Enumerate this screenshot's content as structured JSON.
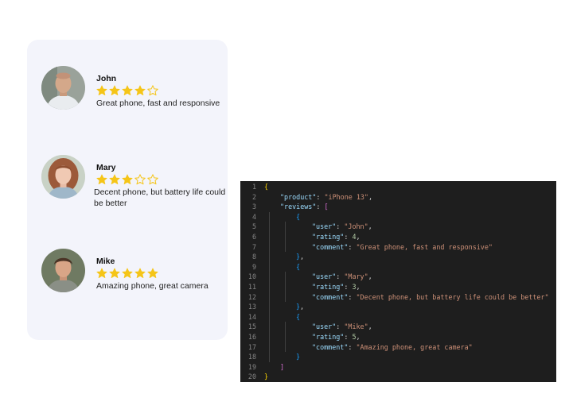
{
  "reviews": [
    {
      "name": "John",
      "rating": 4,
      "max_rating": 5,
      "comment": "Great phone, fast and responsive",
      "avatar_icon": "person-photo-john"
    },
    {
      "name": "Mary",
      "rating": 3,
      "max_rating": 5,
      "comment": "Decent phone, but battery life could be better",
      "avatar_icon": "person-photo-mary"
    },
    {
      "name": "Mike",
      "rating": 5,
      "max_rating": 5,
      "comment": "Amazing phone, great camera",
      "avatar_icon": "person-photo-mike"
    }
  ],
  "colors": {
    "star": "#f5c518",
    "card_bg": "#f3f4fb",
    "editor_bg": "#1e1e1e"
  },
  "code": {
    "line_numbers": [
      "1",
      "2",
      "3",
      "4",
      "5",
      "6",
      "7",
      "8",
      "9",
      "10",
      "11",
      "12",
      "13",
      "14",
      "15",
      "16",
      "17",
      "18",
      "19",
      "20"
    ],
    "lines": [
      [
        {
          "t": "{",
          "c": "b1"
        }
      ],
      [
        {
          "t": "\"product\"",
          "c": "key"
        },
        {
          "t": ": ",
          "c": "punc"
        },
        {
          "t": "\"iPhone 13\"",
          "c": "str"
        },
        {
          "t": ",",
          "c": "punc"
        }
      ],
      [
        {
          "t": "\"reviews\"",
          "c": "key"
        },
        {
          "t": ": ",
          "c": "punc"
        },
        {
          "t": "[",
          "c": "b2"
        }
      ],
      [
        {
          "t": "{",
          "c": "b3"
        }
      ],
      [
        {
          "t": "\"user\"",
          "c": "key"
        },
        {
          "t": ": ",
          "c": "punc"
        },
        {
          "t": "\"John\"",
          "c": "str"
        },
        {
          "t": ",",
          "c": "punc"
        }
      ],
      [
        {
          "t": "\"rating\"",
          "c": "key"
        },
        {
          "t": ": ",
          "c": "punc"
        },
        {
          "t": "4",
          "c": "num"
        },
        {
          "t": ",",
          "c": "punc"
        }
      ],
      [
        {
          "t": "\"comment\"",
          "c": "key"
        },
        {
          "t": ": ",
          "c": "punc"
        },
        {
          "t": "\"Great phone, fast and responsive\"",
          "c": "str"
        }
      ],
      [
        {
          "t": "}",
          "c": "b3"
        },
        {
          "t": ",",
          "c": "punc"
        }
      ],
      [
        {
          "t": "{",
          "c": "b3"
        }
      ],
      [
        {
          "t": "\"user\"",
          "c": "key"
        },
        {
          "t": ": ",
          "c": "punc"
        },
        {
          "t": "\"Mary\"",
          "c": "str"
        },
        {
          "t": ",",
          "c": "punc"
        }
      ],
      [
        {
          "t": "\"rating\"",
          "c": "key"
        },
        {
          "t": ": ",
          "c": "punc"
        },
        {
          "t": "3",
          "c": "num"
        },
        {
          "t": ",",
          "c": "punc"
        }
      ],
      [
        {
          "t": "\"comment\"",
          "c": "key"
        },
        {
          "t": ": ",
          "c": "punc"
        },
        {
          "t": "\"Decent phone, but battery life could be better\"",
          "c": "str"
        }
      ],
      [
        {
          "t": "}",
          "c": "b3"
        },
        {
          "t": ",",
          "c": "punc"
        }
      ],
      [
        {
          "t": "{",
          "c": "b3"
        }
      ],
      [
        {
          "t": "\"user\"",
          "c": "key"
        },
        {
          "t": ": ",
          "c": "punc"
        },
        {
          "t": "\"Mike\"",
          "c": "str"
        },
        {
          "t": ",",
          "c": "punc"
        }
      ],
      [
        {
          "t": "\"rating\"",
          "c": "key"
        },
        {
          "t": ": ",
          "c": "punc"
        },
        {
          "t": "5",
          "c": "num"
        },
        {
          "t": ",",
          "c": "punc"
        }
      ],
      [
        {
          "t": "\"comment\"",
          "c": "key"
        },
        {
          "t": ": ",
          "c": "punc"
        },
        {
          "t": "\"Amazing phone, great camera\"",
          "c": "str"
        }
      ],
      [
        {
          "t": "}",
          "c": "b3"
        }
      ],
      [
        {
          "t": "]",
          "c": "b2"
        }
      ],
      [
        {
          "t": "}",
          "c": "b1"
        }
      ]
    ]
  }
}
